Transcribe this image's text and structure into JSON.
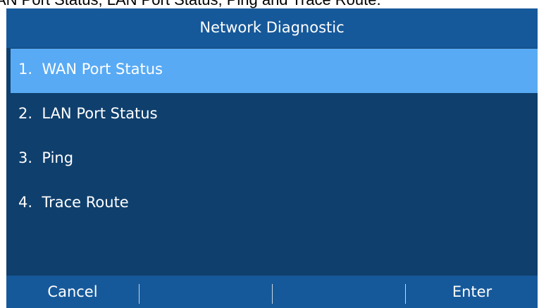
{
  "caption": "AN Port Status, LAN Port Status, Ping and Trace Route.",
  "screen": {
    "title": "Network Diagnostic",
    "menu": [
      {
        "label": "1.  WAN Port Status",
        "selected": true
      },
      {
        "label": "2.  LAN Port Status",
        "selected": false
      },
      {
        "label": "3.  Ping",
        "selected": false
      },
      {
        "label": "4.  Trace Route",
        "selected": false
      }
    ],
    "softkeys": [
      "Cancel",
      "",
      "",
      "Enter"
    ]
  },
  "colors": {
    "screen_bg": "#0f3f6d",
    "bar_bg": "#16599a",
    "highlight": "#58aaf4",
    "text": "#ffffff"
  }
}
